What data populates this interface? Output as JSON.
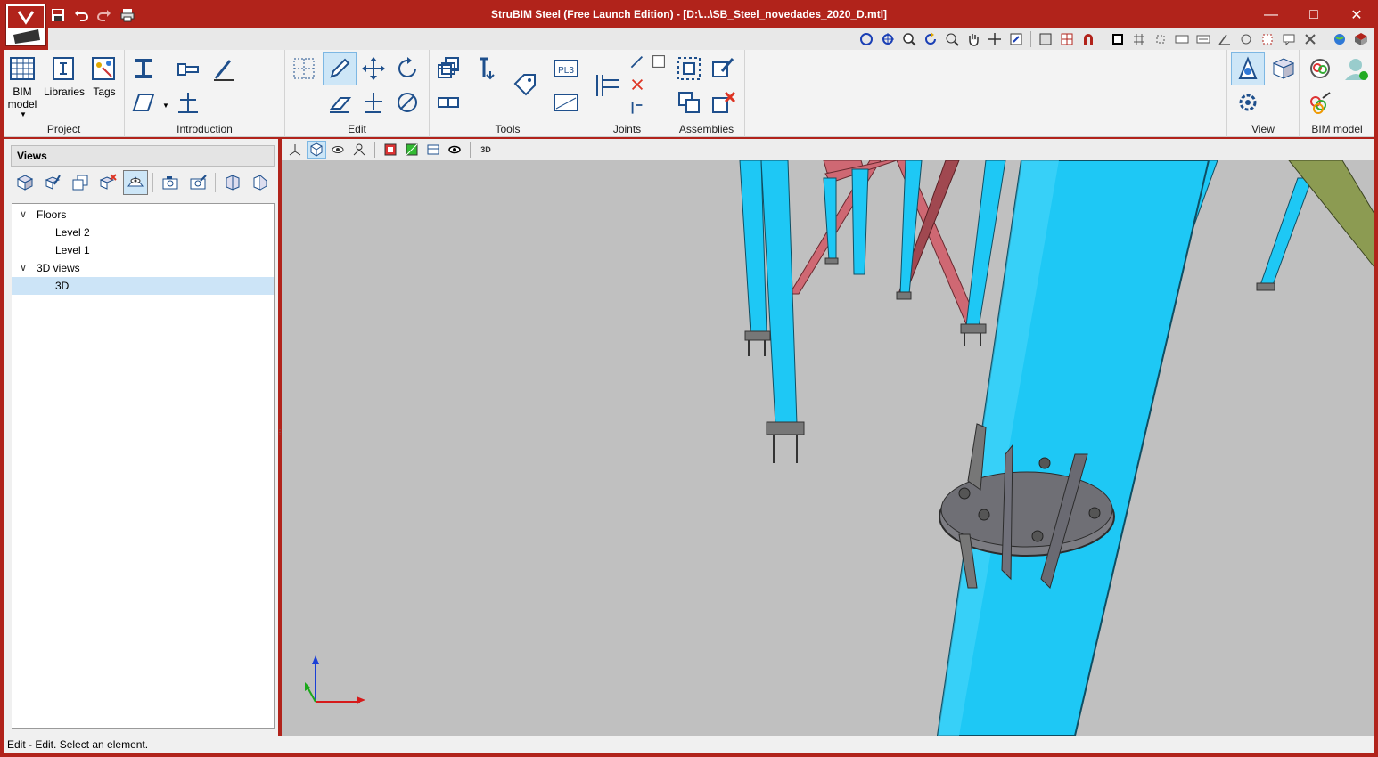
{
  "window": {
    "title": "StruBIM Steel (Free Launch Edition) - [D:\\...\\SB_Steel_novedades_2020_D.mtl]",
    "minimize_icon": "minimize-icon",
    "maximize_icon": "maximize-icon",
    "close_icon": "close-icon"
  },
  "quick_access": [
    "save-icon",
    "undo-icon",
    "redo-icon",
    "print-icon"
  ],
  "ribbon": {
    "project": {
      "label": "Project",
      "bim_model_label": "BIM\nmodel",
      "libraries_label": "Libraries",
      "tags_label": "Tags"
    },
    "introduction": {
      "label": "Introduction"
    },
    "edit": {
      "label": "Edit"
    },
    "tools": {
      "label": "Tools",
      "plate_text": "PL3"
    },
    "joints": {
      "label": "Joints"
    },
    "assemblies": {
      "label": "Assemblies"
    },
    "view": {
      "label": "View"
    },
    "bim_model": {
      "label": "BIM model"
    }
  },
  "panel": {
    "title": "Views",
    "tree": {
      "floors_label": "Floors",
      "level2_label": "Level 2",
      "level1_label": "Level 1",
      "views3d_label": "3D views",
      "view3d_label": "3D"
    }
  },
  "subtoolbar": {
    "label_3d": "3D"
  },
  "status": {
    "text": "Edit - Edit. Select an element."
  },
  "colors": {
    "frame": "#b1231b",
    "member_blue": "#1ec8f5",
    "bracing_red": "#cf6873",
    "plate_gray": "#7c7c82",
    "viewport_bg": "#c0c0c0"
  }
}
